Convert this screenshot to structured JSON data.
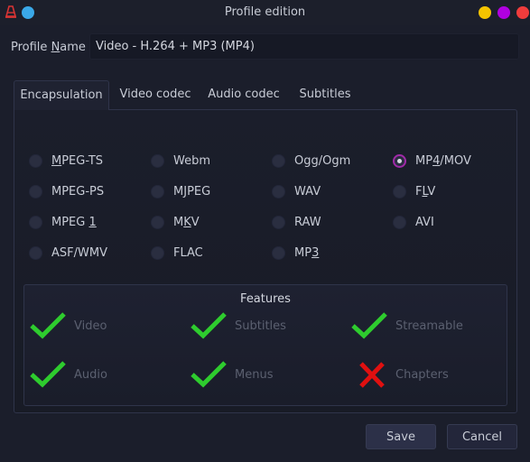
{
  "window": {
    "title": "Profile edition",
    "controls": [
      {
        "name": "minimize",
        "color": "#f5c400"
      },
      {
        "name": "maximize",
        "color": "#b000e0"
      },
      {
        "name": "close",
        "color": "#f03c3c"
      }
    ],
    "left_dot_color": "#3aa8e8"
  },
  "profile": {
    "label_pre": "Profile ",
    "label_mnemonic": "N",
    "label_post": "ame",
    "value": "Video - H.264 + MP3 (MP4)"
  },
  "tabs": [
    {
      "label": "Encapsulation",
      "active": true
    },
    {
      "label": "Video codec",
      "active": false
    },
    {
      "label": "Audio codec",
      "active": false
    },
    {
      "label": "Subtitles",
      "active": false
    }
  ],
  "encapsulation": {
    "options": [
      {
        "pre": "",
        "mn": "M",
        "post": "PEG-TS",
        "checked": false
      },
      {
        "pre": "Webm",
        "mn": "",
        "post": "",
        "checked": false
      },
      {
        "pre": "Ogg/Ogm",
        "mn": "",
        "post": "",
        "checked": false
      },
      {
        "pre": "MP",
        "mn": "4",
        "post": "/MOV",
        "checked": true
      },
      {
        "pre": "MPEG-PS",
        "mn": "",
        "post": "",
        "checked": false
      },
      {
        "pre": "M",
        "mn": "J",
        "post": "PEG",
        "checked": false
      },
      {
        "pre": "WAV",
        "mn": "",
        "post": "",
        "checked": false
      },
      {
        "pre": "F",
        "mn": "L",
        "post": "V",
        "checked": false
      },
      {
        "pre": "MPEG ",
        "mn": "1",
        "post": "",
        "checked": false
      },
      {
        "pre": "M",
        "mn": "K",
        "post": "V",
        "checked": false
      },
      {
        "pre": "RAW",
        "mn": "",
        "post": "",
        "checked": false
      },
      {
        "pre": "AVI",
        "mn": "",
        "post": "",
        "checked": false
      },
      {
        "pre": "ASF/WMV",
        "mn": "",
        "post": "",
        "checked": false
      },
      {
        "pre": "FLAC",
        "mn": "",
        "post": "",
        "checked": false
      },
      {
        "pre": "MP",
        "mn": "3",
        "post": "",
        "checked": false
      }
    ]
  },
  "features": {
    "title": "Features",
    "items": [
      {
        "label": "Video",
        "supported": true
      },
      {
        "label": "Subtitles",
        "supported": true
      },
      {
        "label": "Streamable",
        "supported": true
      },
      {
        "label": "Audio",
        "supported": true
      },
      {
        "label": "Menus",
        "supported": true
      },
      {
        "label": "Chapters",
        "supported": false
      }
    ],
    "colors": {
      "yes": "#2ecc2e",
      "no": "#e01010"
    }
  },
  "buttons": {
    "save": "Save",
    "cancel": "Cancel"
  }
}
